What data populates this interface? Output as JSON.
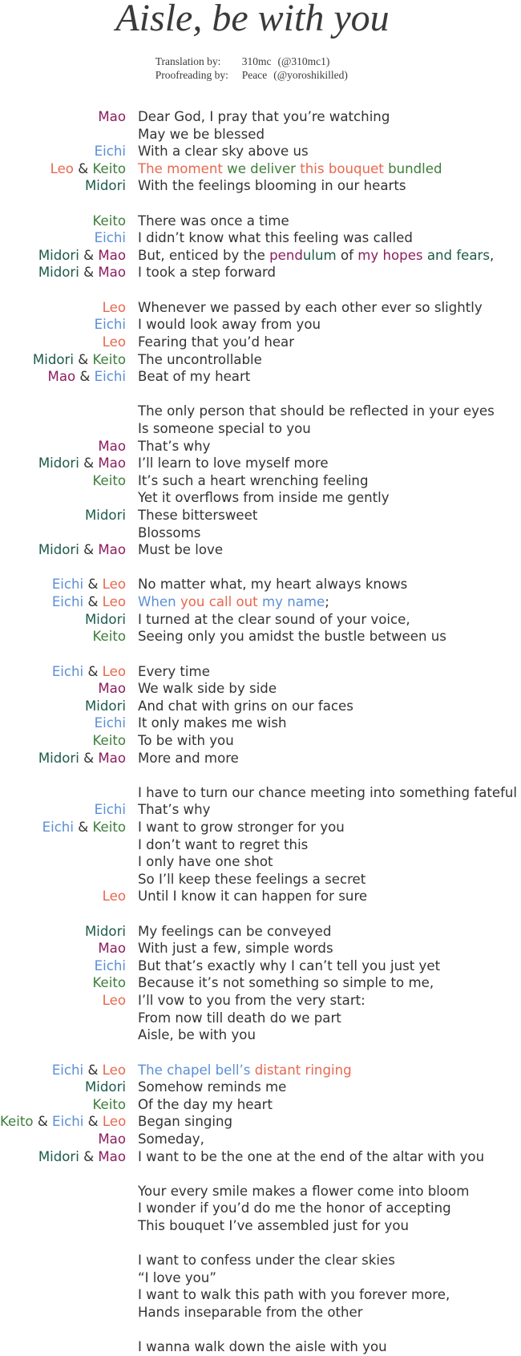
{
  "title": "Aisle, be with you",
  "credits": [
    {
      "role": "Translation by:",
      "name": "310mc",
      "handle": "(@310mc1)"
    },
    {
      "role": "Proofreading by:",
      "name": "Peace",
      "handle": "(@yoroshikilled)"
    }
  ],
  "colors": {
    "Mao": "#8b1e5e",
    "Eichi": "#5b8fd6",
    "Leo": "#e8674f",
    "Keito": "#3d7d3a",
    "Midori": "#1c5a4a",
    "default": "#333333"
  },
  "lyrics": [
    {
      "singers": [
        "Mao"
      ],
      "segs": [
        {
          "t": "Dear God, I pray that you’re watching"
        }
      ]
    },
    {
      "singers": [],
      "segs": [
        {
          "t": "May we be blessed"
        }
      ]
    },
    {
      "singers": [
        "Eichi"
      ],
      "segs": [
        {
          "t": "With a clear sky above us"
        }
      ]
    },
    {
      "singers": [
        "Leo",
        "Keito"
      ],
      "segs": [
        {
          "t": "The moment ",
          "c": "Leo"
        },
        {
          "t": "we deliver ",
          "c": "Keito"
        },
        {
          "t": "this bouquet ",
          "c": "Leo"
        },
        {
          "t": "bundled",
          "c": "Keito"
        }
      ]
    },
    {
      "singers": [
        "Midori"
      ],
      "segs": [
        {
          "t": "With the feelings blooming in our hearts"
        }
      ]
    },
    {
      "blank": true
    },
    {
      "singers": [
        "Keito"
      ],
      "segs": [
        {
          "t": "There was once a time"
        }
      ]
    },
    {
      "singers": [
        "Eichi"
      ],
      "segs": [
        {
          "t": "I didn’t know what this feeling was called"
        }
      ]
    },
    {
      "singers": [
        "Midori",
        "Mao"
      ],
      "segs": [
        {
          "t": "But, enticed by the "
        },
        {
          "t": "pend",
          "c": "Mao"
        },
        {
          "t": "ulum ",
          "c": "Midori"
        },
        {
          "t": "of "
        },
        {
          "t": "my hopes ",
          "c": "Mao"
        },
        {
          "t": "and fears",
          "c": "Midori"
        },
        {
          "t": ","
        }
      ]
    },
    {
      "singers": [
        "Midori",
        "Mao"
      ],
      "segs": [
        {
          "t": "I took a step forward"
        }
      ]
    },
    {
      "blank": true
    },
    {
      "singers": [
        "Leo"
      ],
      "segs": [
        {
          "t": "Whenever we passed by each other ever so slightly"
        }
      ]
    },
    {
      "singers": [
        "Eichi"
      ],
      "segs": [
        {
          "t": "I would look away from you"
        }
      ]
    },
    {
      "singers": [
        "Leo"
      ],
      "segs": [
        {
          "t": "Fearing that you’d hear"
        }
      ]
    },
    {
      "singers": [
        "Midori",
        "Keito"
      ],
      "segs": [
        {
          "t": "The uncontrollable"
        }
      ]
    },
    {
      "singers": [
        "Mao",
        "Eichi"
      ],
      "segs": [
        {
          "t": "Beat of my heart"
        }
      ]
    },
    {
      "blank": true
    },
    {
      "singers": [],
      "segs": [
        {
          "t": "The only person that should be reflected in your eyes"
        }
      ]
    },
    {
      "singers": [],
      "segs": [
        {
          "t": "Is someone special to you"
        }
      ]
    },
    {
      "singers": [
        "Mao"
      ],
      "segs": [
        {
          "t": "That’s why"
        }
      ]
    },
    {
      "singers": [
        "Midori",
        "Mao"
      ],
      "segs": [
        {
          "t": "I’ll learn to love myself more"
        }
      ]
    },
    {
      "singers": [
        "Keito"
      ],
      "segs": [
        {
          "t": "It’s such a heart wrenching feeling"
        }
      ]
    },
    {
      "singers": [],
      "segs": [
        {
          "t": "Yet it overflows from inside me gently"
        }
      ]
    },
    {
      "singers": [
        "Midori"
      ],
      "segs": [
        {
          "t": "These bittersweet"
        }
      ]
    },
    {
      "singers": [],
      "segs": [
        {
          "t": "Blossoms"
        }
      ]
    },
    {
      "singers": [
        "Midori",
        "Mao"
      ],
      "segs": [
        {
          "t": "Must be love"
        }
      ]
    },
    {
      "blank": true
    },
    {
      "singers": [
        "Eichi",
        "Leo"
      ],
      "segs": [
        {
          "t": "No matter what, my heart always knows"
        }
      ]
    },
    {
      "singers": [
        "Eichi",
        "Leo"
      ],
      "segs": [
        {
          "t": "When ",
          "c": "Eichi"
        },
        {
          "t": "you call out ",
          "c": "Leo"
        },
        {
          "t": "my name",
          "c": "Eichi"
        },
        {
          "t": ";"
        }
      ]
    },
    {
      "singers": [
        "Midori"
      ],
      "segs": [
        {
          "t": "I turned at the clear sound of your voice,"
        }
      ]
    },
    {
      "singers": [
        "Keito"
      ],
      "segs": [
        {
          "t": "Seeing only you amidst the bustle between us"
        }
      ]
    },
    {
      "blank": true
    },
    {
      "singers": [
        "Eichi",
        "Leo"
      ],
      "segs": [
        {
          "t": "Every time"
        }
      ]
    },
    {
      "singers": [
        "Mao"
      ],
      "segs": [
        {
          "t": "We walk side by side"
        }
      ]
    },
    {
      "singers": [
        "Midori"
      ],
      "segs": [
        {
          "t": "And chat with grins on our faces"
        }
      ]
    },
    {
      "singers": [
        "Eichi"
      ],
      "segs": [
        {
          "t": "It only makes me wish"
        }
      ]
    },
    {
      "singers": [
        "Keito"
      ],
      "segs": [
        {
          "t": "To be with you"
        }
      ]
    },
    {
      "singers": [
        "Midori",
        "Mao"
      ],
      "segs": [
        {
          "t": "More and more"
        }
      ]
    },
    {
      "blank": true
    },
    {
      "singers": [],
      "segs": [
        {
          "t": "I have to turn our chance meeting into something fateful"
        }
      ]
    },
    {
      "singers": [
        "Eichi"
      ],
      "segs": [
        {
          "t": "That’s why"
        }
      ]
    },
    {
      "singers": [
        "Eichi",
        "Keito"
      ],
      "segs": [
        {
          "t": "I want to grow stronger for you"
        }
      ]
    },
    {
      "singers": [],
      "segs": [
        {
          "t": "I don’t want to regret this"
        }
      ]
    },
    {
      "singers": [],
      "segs": [
        {
          "t": "I only have one shot"
        }
      ]
    },
    {
      "singers": [],
      "segs": [
        {
          "t": "So I’ll keep these feelings a secret"
        }
      ]
    },
    {
      "singers": [
        "Leo"
      ],
      "segs": [
        {
          "t": "Until I know it can happen for sure"
        }
      ]
    },
    {
      "blank": true
    },
    {
      "singers": [
        "Midori"
      ],
      "segs": [
        {
          "t": "My feelings can be conveyed"
        }
      ]
    },
    {
      "singers": [
        "Mao"
      ],
      "segs": [
        {
          "t": "With just a few, simple words"
        }
      ]
    },
    {
      "singers": [
        "Eichi"
      ],
      "segs": [
        {
          "t": "But that’s exactly why I can’t tell you just yet"
        }
      ]
    },
    {
      "singers": [
        "Keito"
      ],
      "segs": [
        {
          "t": "Because it’s not something so simple to me,"
        }
      ]
    },
    {
      "singers": [
        "Leo"
      ],
      "segs": [
        {
          "t": "I’ll vow to you from the very start:"
        }
      ]
    },
    {
      "singers": [],
      "segs": [
        {
          "t": "From now till death do we part"
        }
      ]
    },
    {
      "singers": [],
      "segs": [
        {
          "t": "Aisle, be with you"
        }
      ]
    },
    {
      "blank": true
    },
    {
      "singers": [
        "Eichi",
        "Leo"
      ],
      "segs": [
        {
          "t": "The chapel bell’s ",
          "c": "Eichi"
        },
        {
          "t": "distant ringing",
          "c": "Leo"
        }
      ]
    },
    {
      "singers": [
        "Midori"
      ],
      "segs": [
        {
          "t": "Somehow reminds me"
        }
      ]
    },
    {
      "singers": [
        "Keito"
      ],
      "segs": [
        {
          "t": "Of the day my heart"
        }
      ]
    },
    {
      "singers": [
        "Keito",
        "Eichi",
        "Leo"
      ],
      "segs": [
        {
          "t": "Began singing"
        }
      ]
    },
    {
      "singers": [
        "Mao"
      ],
      "segs": [
        {
          "t": "Someday,"
        }
      ]
    },
    {
      "singers": [
        "Midori",
        "Mao"
      ],
      "segs": [
        {
          "t": "I want to be the one at the end of the altar with you"
        }
      ]
    },
    {
      "blank": true
    },
    {
      "singers": [],
      "segs": [
        {
          "t": "Your every smile makes a flower come into bloom"
        }
      ]
    },
    {
      "singers": [],
      "segs": [
        {
          "t": "I wonder if you’d do me the honor of accepting"
        }
      ]
    },
    {
      "singers": [],
      "segs": [
        {
          "t": "This bouquet I’ve assembled just for you"
        }
      ]
    },
    {
      "blank": true
    },
    {
      "singers": [],
      "segs": [
        {
          "t": "I want to confess under the clear skies"
        }
      ]
    },
    {
      "singers": [],
      "segs": [
        {
          "t": "“I love you”"
        }
      ]
    },
    {
      "singers": [],
      "segs": [
        {
          "t": "I want to walk this path with you forever more,"
        }
      ]
    },
    {
      "singers": [],
      "segs": [
        {
          "t": "Hands inseparable from the other"
        }
      ]
    },
    {
      "blank": true
    },
    {
      "singers": [],
      "segs": [
        {
          "t": "I wanna walk down the aisle with you"
        }
      ]
    }
  ],
  "amp_symbol": "&"
}
